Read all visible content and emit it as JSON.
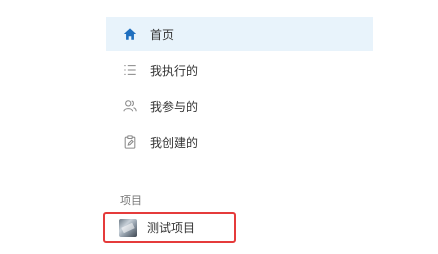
{
  "sidebar": {
    "items": [
      {
        "label": "首页",
        "icon": "home-icon",
        "active": true
      },
      {
        "label": "我执行的",
        "icon": "list-icon",
        "active": false
      },
      {
        "label": "我参与的",
        "icon": "users-icon",
        "active": false
      },
      {
        "label": "我创建的",
        "icon": "clipboard-edit-icon",
        "active": false
      }
    ],
    "section_title": "项目",
    "projects": [
      {
        "label": "测试项目",
        "icon": "project-thumbnail",
        "highlighted": true
      }
    ]
  },
  "colors": {
    "accent": "#1f6fbf",
    "active_bg": "#e8f3fb",
    "highlight_border": "#e53b3b"
  }
}
